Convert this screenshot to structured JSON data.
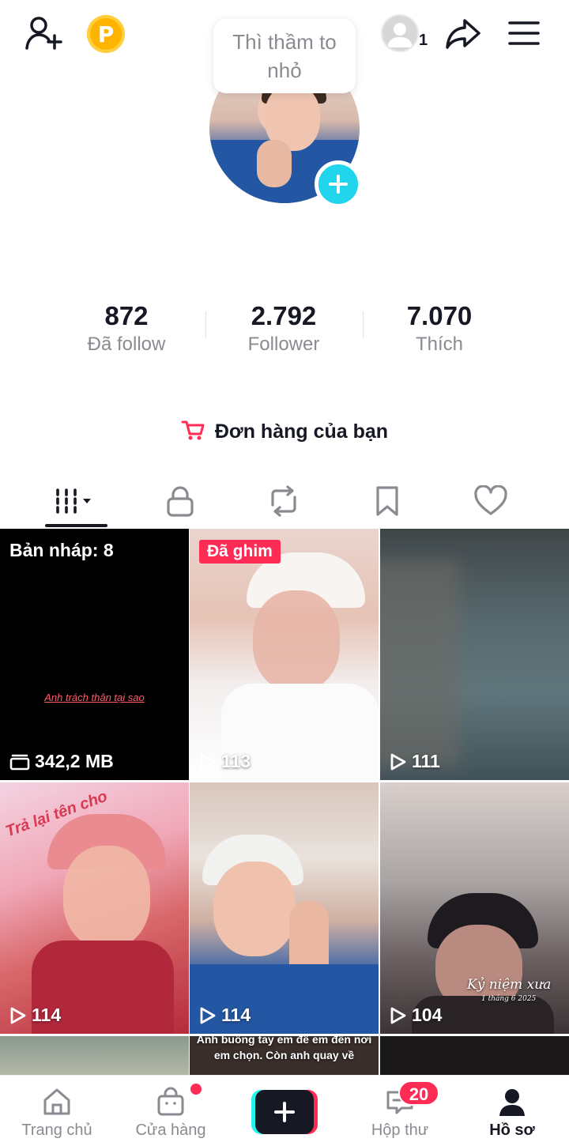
{
  "header": {
    "bubble_text": "Thì thầm to nhỏ",
    "coin_letter": "P",
    "mini_avatar_count": "1",
    "icons": [
      "add-friend-icon",
      "coin-icon",
      "share-icon",
      "menu-icon"
    ]
  },
  "stats": [
    {
      "value": "872",
      "label": "Đã follow"
    },
    {
      "value": "2.792",
      "label": "Follower"
    },
    {
      "value": "7.070",
      "label": "Thích"
    }
  ],
  "orders": {
    "label": "Đơn hàng của bạn"
  },
  "tabs": [
    "videos-tab",
    "private-tab",
    "reposts-tab",
    "favorites-tab",
    "liked-tab"
  ],
  "grid": {
    "draft": {
      "title": "Bản nháp: 8",
      "caption": "Anh trách thân tại sao",
      "size": "342,2 MB"
    },
    "pinned_badge": "Đã ghim",
    "views": [
      "113",
      "111",
      "114",
      "114",
      "104"
    ],
    "overlays": {
      "cell4_text": "Trả lại tên cho",
      "cell6_text": "Kỷ niệm xưa",
      "cell6_date": "1 tháng 6 2025",
      "cell8_text": "Anh buông tay em để em đến nơi em chọn. Còn anh quay về"
    }
  },
  "bottom_nav": {
    "home": "Trang chủ",
    "shop": "Cửa hàng",
    "inbox": "Hộp thư",
    "inbox_badge": "20",
    "profile": "Hồ sơ"
  },
  "colors": {
    "accent": "#fe2c55",
    "cyan": "#25f4ee",
    "text": "#161823",
    "muted": "#8a8b91"
  }
}
